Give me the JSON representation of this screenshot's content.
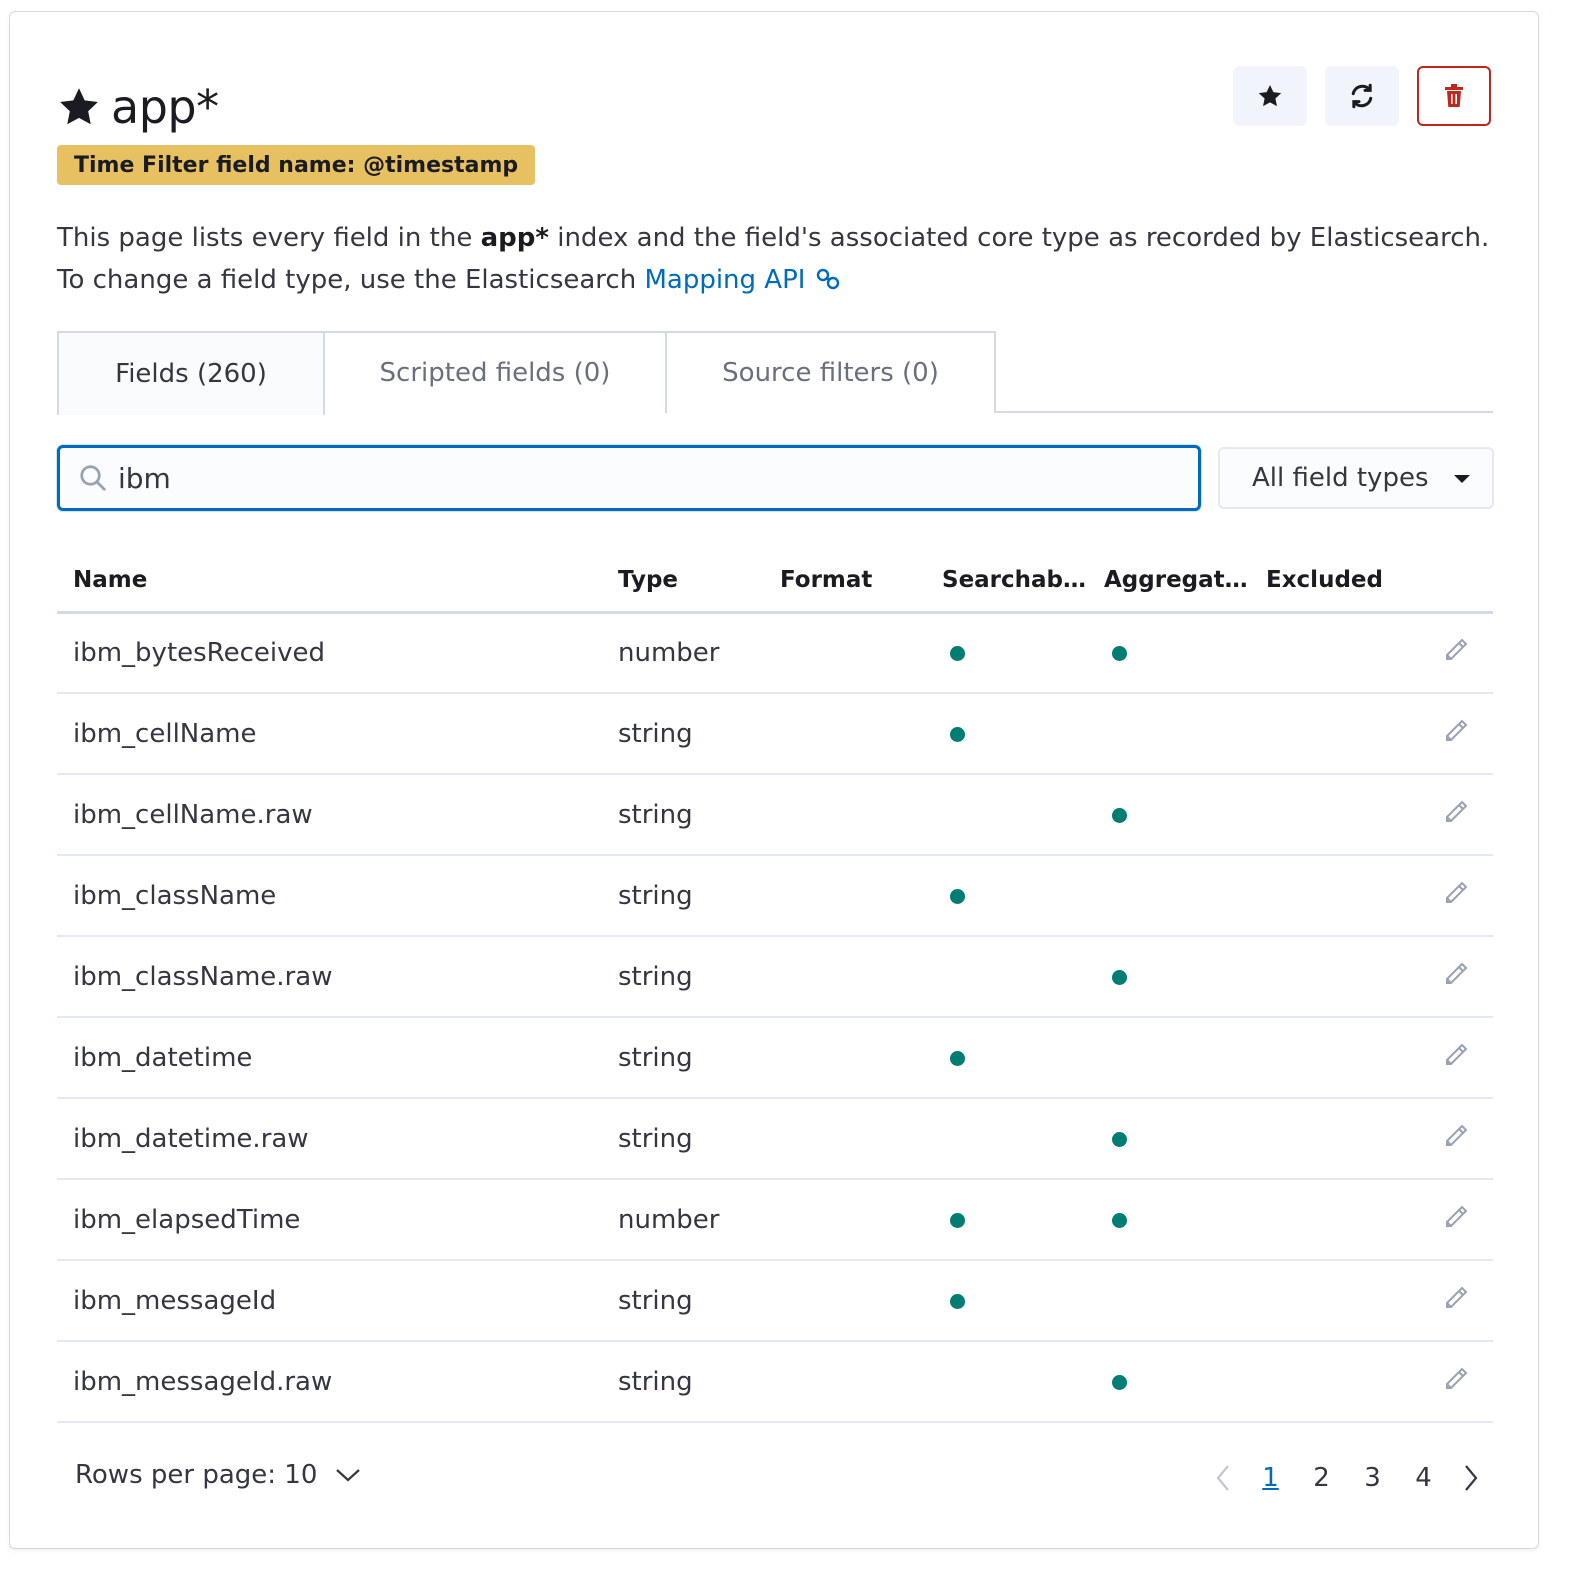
{
  "header": {
    "title": "app*",
    "time_filter_badge": "Time Filter field name: @timestamp"
  },
  "actions": [
    {
      "name": "set-default-button",
      "icon": "star-icon"
    },
    {
      "name": "refresh-fields-button",
      "icon": "refresh-icon"
    },
    {
      "name": "delete-index-pattern-button",
      "icon": "trash-icon"
    }
  ],
  "description": {
    "part1": "This page lists every field in the ",
    "bold": "app*",
    "part2": " index and the field's associated core type as recorded by Elasticsearch. To change a field type, use the Elasticsearch ",
    "link": "Mapping API"
  },
  "tabs": [
    {
      "label": "Fields (260)",
      "active": true
    },
    {
      "label": "Scripted fields (0)",
      "active": false
    },
    {
      "label": "Source filters (0)",
      "active": false
    }
  ],
  "search": {
    "value": "ibm",
    "placeholder": "Search"
  },
  "type_filter": {
    "selected": "All field types"
  },
  "table": {
    "columns": [
      "Name",
      "Type",
      "Format",
      "Searchab...",
      "Aggregat...",
      "Excluded"
    ],
    "rows": [
      {
        "name": "ibm_bytesReceived",
        "type": "number",
        "format": "",
        "searchable": true,
        "aggregatable": true,
        "excluded": false
      },
      {
        "name": "ibm_cellName",
        "type": "string",
        "format": "",
        "searchable": true,
        "aggregatable": false,
        "excluded": false
      },
      {
        "name": "ibm_cellName.raw",
        "type": "string",
        "format": "",
        "searchable": false,
        "aggregatable": true,
        "excluded": false
      },
      {
        "name": "ibm_className",
        "type": "string",
        "format": "",
        "searchable": true,
        "aggregatable": false,
        "excluded": false
      },
      {
        "name": "ibm_className.raw",
        "type": "string",
        "format": "",
        "searchable": false,
        "aggregatable": true,
        "excluded": false
      },
      {
        "name": "ibm_datetime",
        "type": "string",
        "format": "",
        "searchable": true,
        "aggregatable": false,
        "excluded": false
      },
      {
        "name": "ibm_datetime.raw",
        "type": "string",
        "format": "",
        "searchable": false,
        "aggregatable": true,
        "excluded": false
      },
      {
        "name": "ibm_elapsedTime",
        "type": "number",
        "format": "",
        "searchable": true,
        "aggregatable": true,
        "excluded": false
      },
      {
        "name": "ibm_messageId",
        "type": "string",
        "format": "",
        "searchable": true,
        "aggregatable": false,
        "excluded": false
      },
      {
        "name": "ibm_messageId.raw",
        "type": "string",
        "format": "",
        "searchable": false,
        "aggregatable": true,
        "excluded": false
      }
    ]
  },
  "pagination": {
    "rows_per_page_label": "Rows per page: 10",
    "pages": [
      "1",
      "2",
      "3",
      "4"
    ],
    "current_page": "1"
  },
  "colors": {
    "accent": "#006bb8",
    "badge": "#e7c062",
    "dot": "#017d73",
    "danger": "#bd271e"
  }
}
